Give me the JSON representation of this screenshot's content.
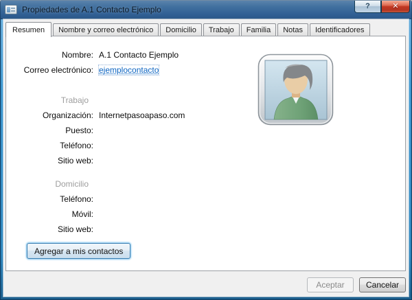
{
  "window": {
    "title": "Propiedades de A.1 Contacto Ejemplo",
    "controls": {
      "help": "?",
      "close": "✕"
    }
  },
  "tabs": [
    {
      "label": "Resumen",
      "active": true
    },
    {
      "label": "Nombre y correo electrónico",
      "active": false
    },
    {
      "label": "Domicilio",
      "active": false
    },
    {
      "label": "Trabajo",
      "active": false
    },
    {
      "label": "Familia",
      "active": false
    },
    {
      "label": "Notas",
      "active": false
    },
    {
      "label": "Identificadores",
      "active": false
    }
  ],
  "summary": {
    "name_label": "Nombre:",
    "name_value": "A.1 Contacto Ejemplo",
    "email_label": "Correo electrónico:",
    "email_value": "ejemplocontacto",
    "work": {
      "header": "Trabajo",
      "rows": [
        {
          "label": "Organización:",
          "value": "Internetpasoapaso.com"
        },
        {
          "label": "Puesto:",
          "value": ""
        },
        {
          "label": "Teléfono:",
          "value": ""
        },
        {
          "label": "Sitio web:",
          "value": ""
        }
      ]
    },
    "home": {
      "header": "Domicilio",
      "rows": [
        {
          "label": "Teléfono:",
          "value": ""
        },
        {
          "label": "Móvil:",
          "value": ""
        },
        {
          "label": "Sitio web:",
          "value": ""
        }
      ]
    },
    "add_button": "Agregar a mis contactos"
  },
  "footer": {
    "ok": "Aceptar",
    "cancel": "Cancelar"
  },
  "colors": {
    "titlebar": "#3a699b",
    "frame": "#3e97cf",
    "dialog_bg": "#f0f0f0",
    "link": "#0a63c1",
    "section_header": "#9d9d9d",
    "close_button": "#c23823"
  }
}
